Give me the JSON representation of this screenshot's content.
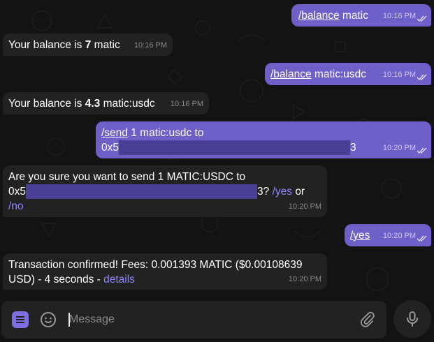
{
  "colors": {
    "outgoing": "#6e5fc9",
    "incoming": "#222222",
    "link": "#8f86ff",
    "background": "#131313"
  },
  "messages": [
    {
      "dir": "out",
      "command": "/balance",
      "text": " matic",
      "time": "10:16 PM"
    },
    {
      "dir": "in",
      "pre": "Your balance is ",
      "bold": "7",
      "post": " matic",
      "time": "10:16 PM"
    },
    {
      "dir": "out",
      "command": "/balance",
      "text": " matic:usdc",
      "time": "10:16 PM"
    },
    {
      "dir": "in",
      "pre": "Your balance is ",
      "bold": "4.3",
      "post": " matic:usdc",
      "time": "10:16 PM"
    },
    {
      "dir": "out",
      "command": "/send",
      "text": " 1 matic:usdc to",
      "line2_start": "0x5",
      "line2_end": "3",
      "time": "10:20 PM"
    },
    {
      "dir": "in",
      "line1": "Are you sure you want to send 1 MATIC:USDC to",
      "line2_start": "0x5",
      "line2_end": "3?",
      "yes": "/yes",
      "or": "or",
      "no": "/no",
      "time": "10:20 PM"
    },
    {
      "dir": "out",
      "command": "/yes",
      "time": "10:20 PM"
    },
    {
      "dir": "in",
      "line1": "Transaction confirmed! Fees: 0.001393 MATIC ($0.00108639",
      "line2": "USD) - 4 seconds - ",
      "link": "details",
      "time": "10:20 PM"
    }
  ],
  "composer": {
    "placeholder": "Message",
    "menu_icon": "menu-icon",
    "emoji_icon": "emoji-icon",
    "attach_icon": "paperclip-icon",
    "mic_icon": "microphone-icon"
  }
}
